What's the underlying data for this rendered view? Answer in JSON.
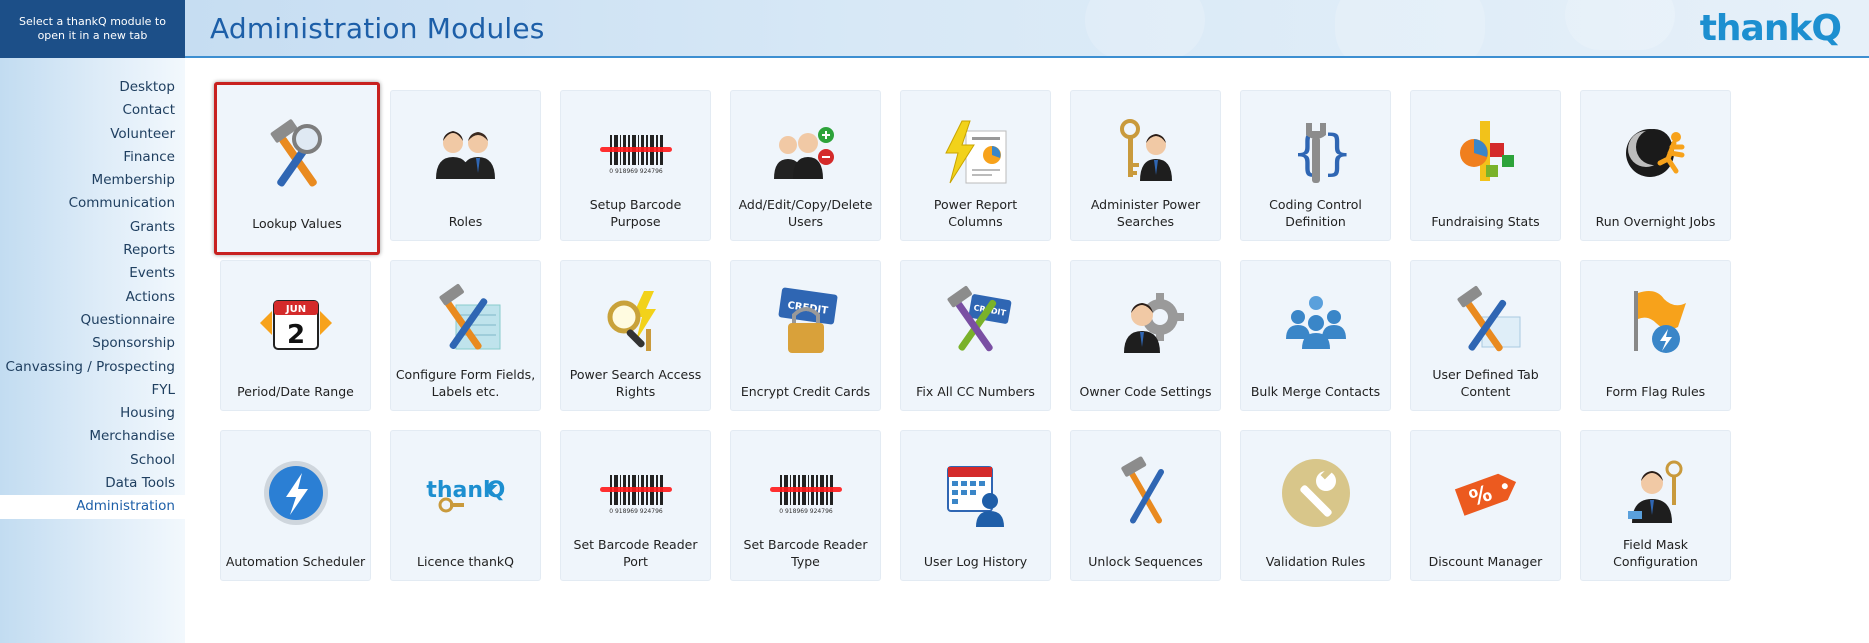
{
  "sidebar": {
    "hint": "Select a thankQ module to open it in a new tab",
    "items": [
      {
        "label": "Desktop"
      },
      {
        "label": "Contact"
      },
      {
        "label": "Volunteer"
      },
      {
        "label": "Finance"
      },
      {
        "label": "Membership"
      },
      {
        "label": "Communication"
      },
      {
        "label": "Grants"
      },
      {
        "label": "Reports"
      },
      {
        "label": "Events"
      },
      {
        "label": "Actions"
      },
      {
        "label": "Questionnaire"
      },
      {
        "label": "Sponsorship"
      },
      {
        "label": "Canvassing / Prospecting"
      },
      {
        "label": "FYL"
      },
      {
        "label": "Housing"
      },
      {
        "label": "Merchandise"
      },
      {
        "label": "School"
      },
      {
        "label": "Data Tools"
      },
      {
        "label": "Administration"
      }
    ],
    "active": "Administration"
  },
  "header": {
    "title": "Administration Modules",
    "logo_text": "thank",
    "logo_q": "Q"
  },
  "modules": [
    {
      "label": "Lookup Values",
      "icon": "hammer-wrench-magnifier-icon",
      "selected": true
    },
    {
      "label": "Roles",
      "icon": "people-roles-icon"
    },
    {
      "label": "Setup Barcode Purpose",
      "icon": "barcode-laser-icon"
    },
    {
      "label": "Add/Edit/Copy/Delete Users",
      "icon": "users-add-remove-icon"
    },
    {
      "label": "Power Report Columns",
      "icon": "lightning-report-icon"
    },
    {
      "label": "Administer Power Searches",
      "icon": "key-person-icon"
    },
    {
      "label": "Coding Control Definition",
      "icon": "wrench-braces-icon"
    },
    {
      "label": "Fundraising Stats",
      "icon": "stats-blocks-icon"
    },
    {
      "label": "Run Overnight Jobs",
      "icon": "moon-runner-icon"
    },
    {
      "label": "Period/Date Range",
      "icon": "calendar-arrows-icon",
      "cal_month": "JUN",
      "cal_day": "2"
    },
    {
      "label": "Configure Form Fields, Labels etc.",
      "icon": "tools-form-icon"
    },
    {
      "label": "Power Search Access Rights",
      "icon": "magnifier-key-icon"
    },
    {
      "label": "Encrypt Credit Cards",
      "icon": "credit-card-lock-icon",
      "card_text": "CREDIT"
    },
    {
      "label": "Fix All CC Numbers",
      "icon": "tools-credit-card-icon",
      "card_text": "CREDIT"
    },
    {
      "label": "Owner Code Settings",
      "icon": "person-gear-icon"
    },
    {
      "label": "Bulk Merge Contacts",
      "icon": "merge-people-icon"
    },
    {
      "label": "User Defined Tab Content",
      "icon": "tools-tab-icon"
    },
    {
      "label": "Form Flag Rules",
      "icon": "flag-icon"
    },
    {
      "label": "Automation Scheduler",
      "icon": "lightning-orb-icon"
    },
    {
      "label": "Licence thankQ",
      "icon": "thankq-key-icon",
      "logo_text": "thank",
      "logo_q": "Q"
    },
    {
      "label": "Set Barcode Reader Port",
      "icon": "barcode-laser-icon"
    },
    {
      "label": "Set Barcode Reader Type",
      "icon": "barcode-laser-icon"
    },
    {
      "label": "User Log History",
      "icon": "calendar-user-icon"
    },
    {
      "label": "Unlock Sequences",
      "icon": "hammer-screwdriver-icon"
    },
    {
      "label": "Validation Rules",
      "icon": "wrench-circle-icon"
    },
    {
      "label": "Discount Manager",
      "icon": "discount-tag-icon",
      "tag_text": "%"
    },
    {
      "label": "Field Mask Configuration",
      "icon": "person-key-icon"
    }
  ]
}
